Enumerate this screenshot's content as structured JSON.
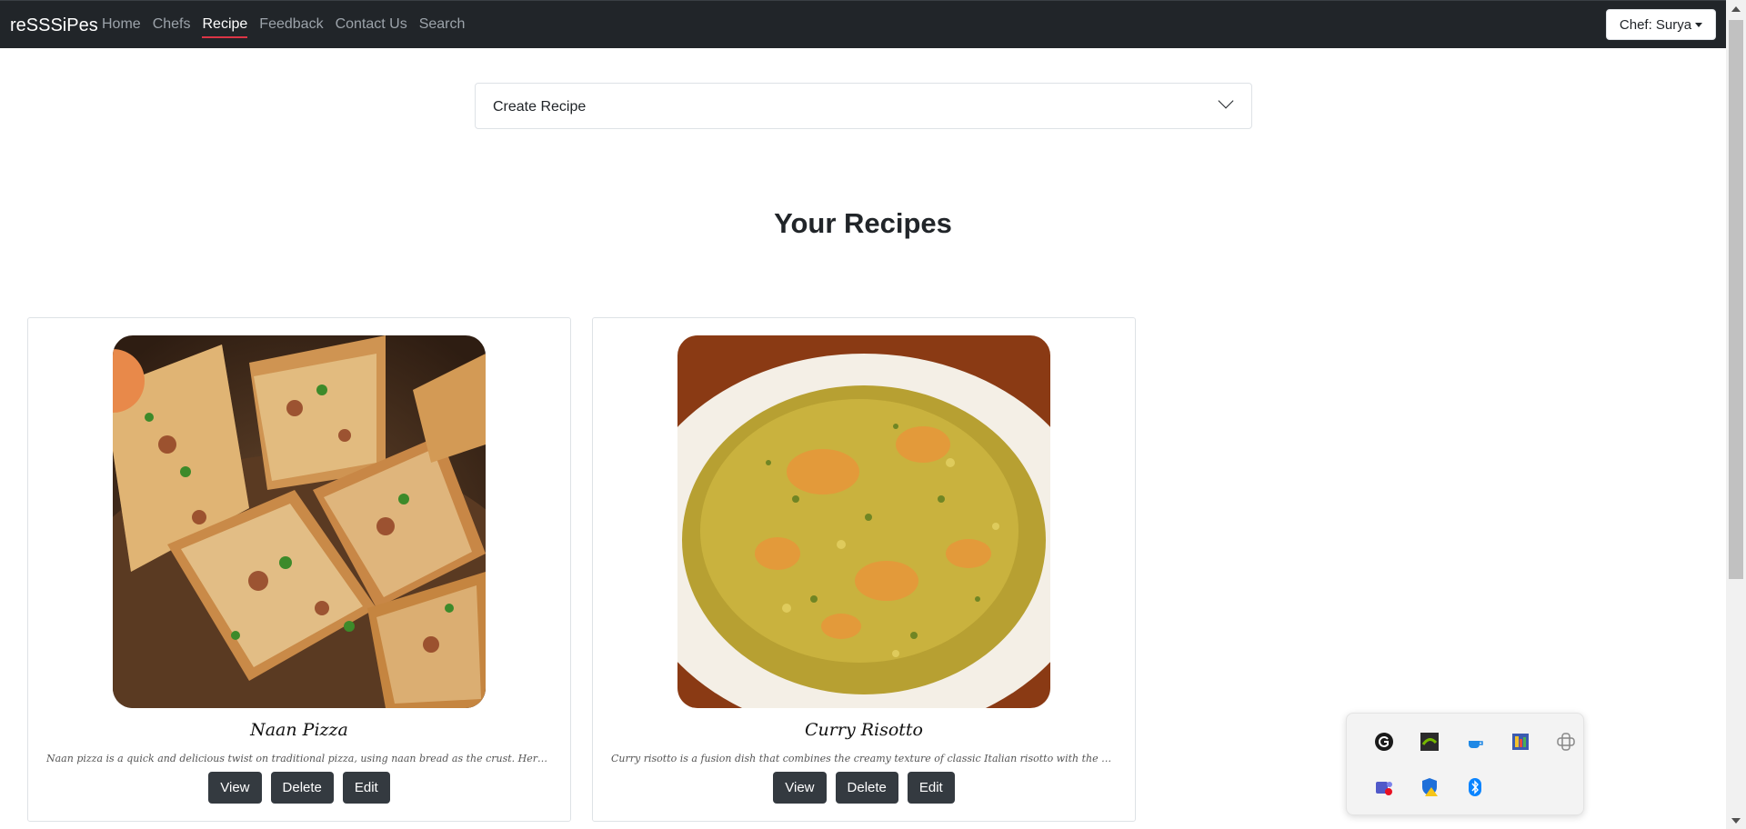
{
  "navbar": {
    "brand": "reSSSiPes",
    "links": [
      "Home",
      "Chefs",
      "Recipe",
      "Feedback",
      "Contact Us",
      "Search"
    ],
    "active_link": "Recipe",
    "chef_menu_label": "Chef: Surya"
  },
  "create_recipe": {
    "label": "Create Recipe"
  },
  "section_title": "Your Recipes",
  "recipes": [
    {
      "title": "Naan Pizza",
      "description": "Naan pizza is a quick and delicious twist on traditional pizza, using naan bread as the crust. Here's a simple g...",
      "image": "naan-pizza-photo",
      "buttons": [
        "View",
        "Delete",
        "Edit"
      ]
    },
    {
      "title": "Curry Risotto",
      "description": "Curry risotto is a fusion dish that combines the creamy texture of classic Italian risotto with the aromatic flav...",
      "image": "curry-risotto-photo",
      "buttons": [
        "View",
        "Delete",
        "Edit"
      ]
    }
  ],
  "tray_icons": [
    "ghub-icon",
    "nvidia-icon",
    "java-icon",
    "app-icon",
    "network-icon",
    "teams-icon",
    "defender-warning-icon",
    "bluetooth-icon"
  ],
  "colors": {
    "navbar_bg": "#212529",
    "active_underline": "#dc3545",
    "button_dark": "#343a40"
  }
}
